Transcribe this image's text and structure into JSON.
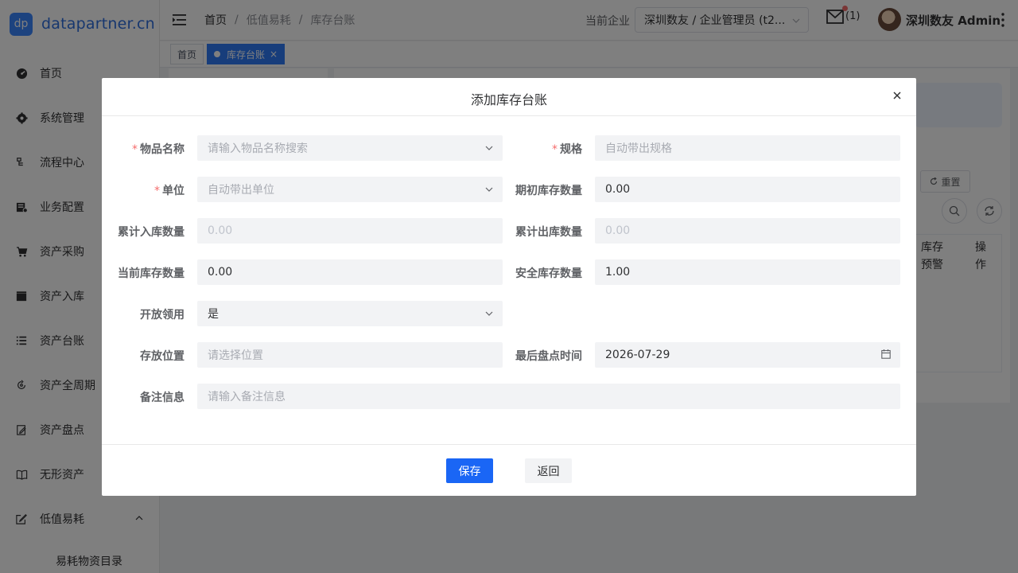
{
  "brand": {
    "logo_text": "dp",
    "name": "datapartner.cn"
  },
  "sidebar": {
    "items": [
      {
        "label": "首页",
        "icon": "dashboard-icon"
      },
      {
        "label": "系统管理",
        "icon": "gear-icon"
      },
      {
        "label": "流程中心",
        "icon": "flow-icon"
      },
      {
        "label": "业务配置",
        "icon": "config-icon"
      },
      {
        "label": "资产采购",
        "icon": "cart-icon"
      },
      {
        "label": "资产入库",
        "icon": "clapper-icon"
      },
      {
        "label": "资产台账",
        "icon": "list-icon"
      },
      {
        "label": "资产全周期",
        "icon": "cycle-icon"
      },
      {
        "label": "资产盘点",
        "icon": "edit-icon"
      },
      {
        "label": "无形资产",
        "icon": "book-icon"
      },
      {
        "label": "低值易耗",
        "icon": "edit-square-icon",
        "expanded": true
      }
    ],
    "subitem": "易耗物资目录"
  },
  "header": {
    "breadcrumb": [
      "首页",
      "低值易耗",
      "库存台账"
    ],
    "company_label": "当前企业",
    "company_value": "深圳数友 / 企业管理员 (t2...",
    "mail_count": "(1)",
    "username": "深圳数友 Admin"
  },
  "tabs": [
    {
      "label": "首页",
      "active": false
    },
    {
      "label": "库存台账",
      "active": true
    }
  ],
  "background": {
    "reset_label": "重置",
    "col_stock_warn": [
      "库存",
      "预警"
    ],
    "col_ops": [
      "操",
      "作"
    ]
  },
  "dialog": {
    "title": "添加库存台账",
    "fields": {
      "item_name": {
        "label": "物品名称",
        "required": true,
        "placeholder": "请输入物品名称搜索"
      },
      "spec": {
        "label": "规格",
        "required": true,
        "placeholder": "自动带出规格"
      },
      "unit": {
        "label": "单位",
        "required": true,
        "placeholder": "自动带出单位"
      },
      "initial_stock": {
        "label": "期初库存数量",
        "value": "0.00"
      },
      "total_in": {
        "label": "累计入库数量",
        "value": "0.00"
      },
      "total_out": {
        "label": "累计出库数量",
        "value": "0.00"
      },
      "current_stock": {
        "label": "当前库存数量",
        "value": "0.00"
      },
      "safety_stock": {
        "label": "安全库存数量",
        "value": "1.00"
      },
      "open_use": {
        "label": "开放领用",
        "value": "是"
      },
      "location": {
        "label": "存放位置",
        "placeholder": "请选择位置"
      },
      "last_check": {
        "label": "最后盘点时间",
        "value": "2026-07-29"
      },
      "remark": {
        "label": "备注信息",
        "placeholder": "请输入备注信息"
      }
    },
    "save_label": "保存",
    "back_label": "返回"
  }
}
